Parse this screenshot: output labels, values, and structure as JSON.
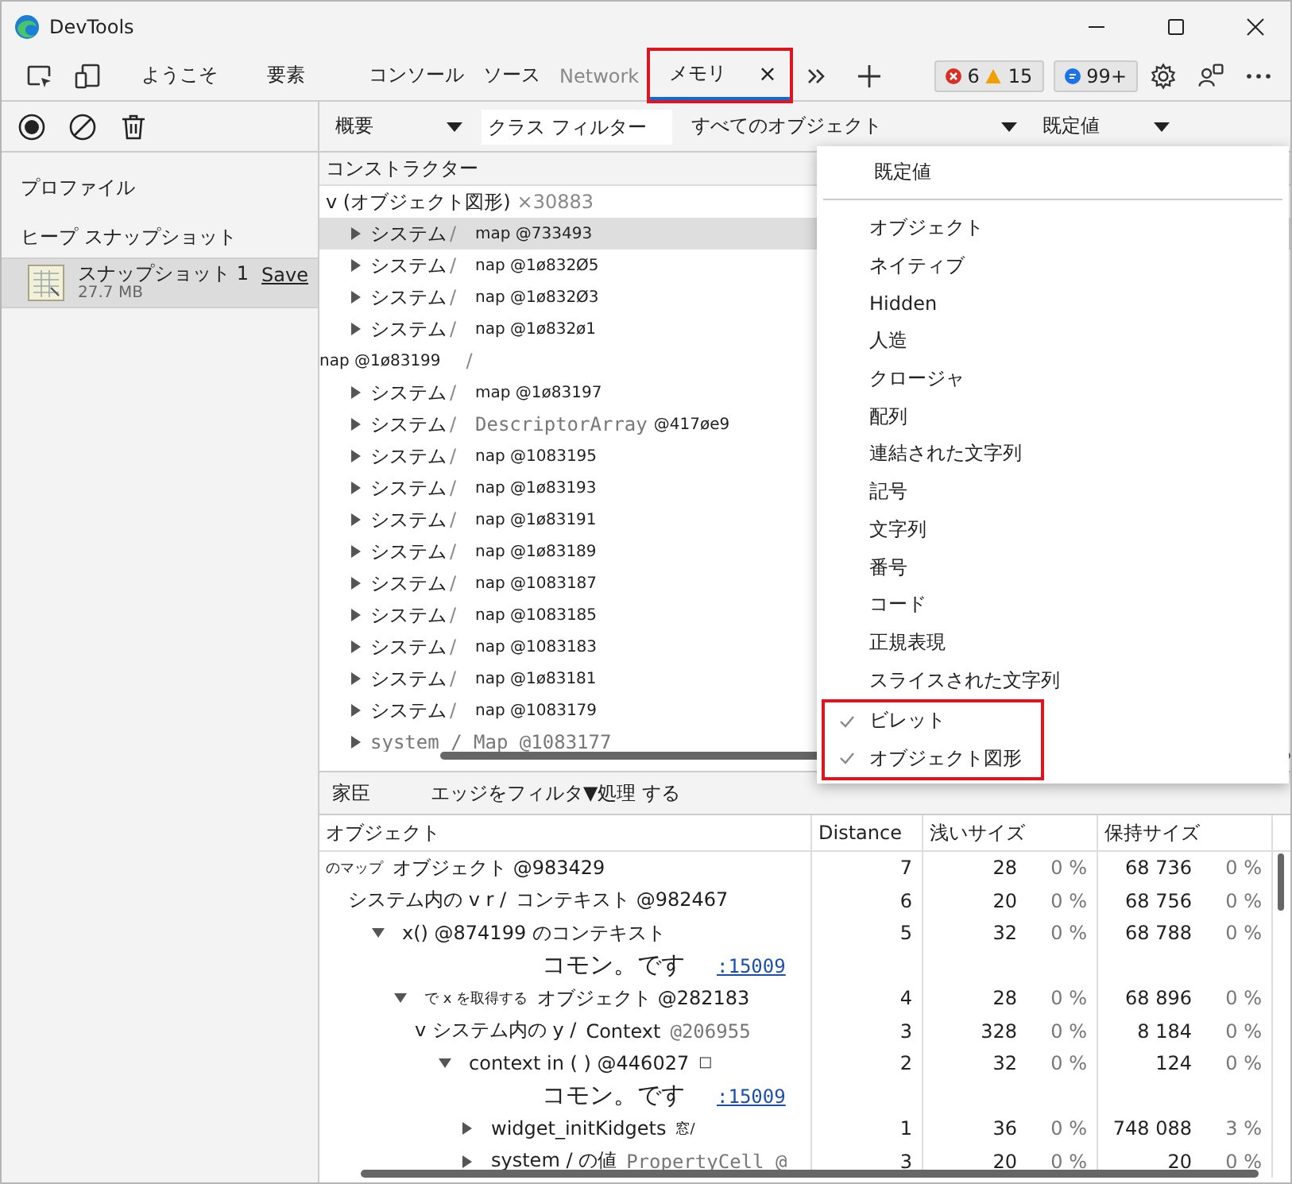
{
  "window": {
    "title": "DevTools"
  },
  "tabs": [
    {
      "label": "ようこそ",
      "selected": false,
      "disabled": false,
      "highlighted": false
    },
    {
      "label": "要素",
      "selected": false,
      "disabled": false,
      "highlighted": false
    },
    {
      "label": "コンソール",
      "selected": false,
      "disabled": false,
      "highlighted": false
    },
    {
      "label": "ソース",
      "selected": false,
      "disabled": false,
      "highlighted": false
    },
    {
      "label": "Network",
      "selected": false,
      "disabled": true,
      "highlighted": false
    },
    {
      "label": "メモリ",
      "selected": true,
      "disabled": false,
      "highlighted": true,
      "close": "×"
    }
  ],
  "status_counts": {
    "errors": "6",
    "warnings": "15",
    "issues": "99+"
  },
  "toolbar": {
    "view": "概要",
    "class_filter": {
      "placeholder": "クラス フィルター"
    },
    "object_filter": "すべてのオブジェクト",
    "preset": "既定値"
  },
  "sidebar": {
    "profiles_heading": "プロファイル",
    "group_heading": "ヒープ スナップショット",
    "snapshots": [
      {
        "name": "スナップショット 1",
        "size": "27.7 MB",
        "action": "Save",
        "selected": true
      }
    ]
  },
  "constructors": {
    "column": "コンストラクター",
    "groups": [
      {
        "label": "v (オブジェクト図形)",
        "count": "×30883",
        "children": [
          {
            "kind": "object",
            "name": "システム",
            "sep": "/",
            "detail": "map @733493",
            "expanded": false,
            "selected": true
          },
          {
            "kind": "object",
            "name": "システム",
            "sep": "/",
            "detail": "nap @1ø832Ø5",
            "expanded": false,
            "selected": false
          },
          {
            "kind": "object",
            "name": "システム",
            "sep": "/",
            "detail": "nap @1ø832Ø3",
            "expanded": false,
            "selected": false
          },
          {
            "kind": "object",
            "name": "システム",
            "sep": "/",
            "detail": "nap @1ø832ø1",
            "expanded": false,
            "selected": false
          },
          {
            "kind": "shifted",
            "sep": "/",
            "overlay": "nap @1ø83199",
            "selected": false
          },
          {
            "kind": "object",
            "name": "システム",
            "sep": "/",
            "detail": "map @1ø83197",
            "expanded": false,
            "selected": false
          },
          {
            "kind": "object",
            "name": "システム",
            "sep": "/",
            "type": "DescriptorArray",
            "detail": "@417øe9",
            "expanded": false,
            "selected": false
          },
          {
            "kind": "object",
            "name": "システム",
            "sep": "/",
            "detail": "nap @1083195",
            "expanded": false,
            "selected": false
          },
          {
            "kind": "object",
            "name": "システム",
            "sep": "/",
            "detail": "nap @1ø83193",
            "expanded": false,
            "selected": false
          },
          {
            "kind": "object",
            "name": "システム",
            "sep": "/",
            "detail": "nap @1ø83191",
            "expanded": false,
            "selected": false
          },
          {
            "kind": "object",
            "name": "システム",
            "sep": "/",
            "detail": "nap @1ø83189",
            "expanded": false,
            "selected": false
          },
          {
            "kind": "object",
            "name": "システム",
            "sep": "/",
            "detail": "nap @1083187",
            "expanded": false,
            "selected": false
          },
          {
            "kind": "object",
            "name": "システム",
            "sep": "/",
            "detail": "nap @1083185",
            "expanded": false,
            "selected": false
          },
          {
            "kind": "object",
            "name": "システム",
            "sep": "/",
            "detail": "nap @1083183",
            "expanded": false,
            "selected": false
          },
          {
            "kind": "object",
            "name": "システム",
            "sep": "/",
            "detail": "nap @1ø83181",
            "expanded": false,
            "selected": false
          },
          {
            "kind": "object",
            "name": "システム",
            "sep": "/",
            "detail": "nap @1083179",
            "expanded": false,
            "selected": false
          },
          {
            "kind": "mono",
            "text": "system / Map @1083177",
            "expanded": false,
            "selected": false
          }
        ]
      }
    ]
  },
  "type_menu": {
    "header": "既定値",
    "items": [
      {
        "label": "オブジェクト",
        "checked": false,
        "highlighted": false
      },
      {
        "label": "ネイティブ",
        "checked": false,
        "highlighted": false
      },
      {
        "label": "Hidden",
        "checked": false,
        "highlighted": false
      },
      {
        "label": "人造",
        "checked": false,
        "highlighted": false
      },
      {
        "label": "クロージャ",
        "checked": false,
        "highlighted": false
      },
      {
        "label": "配列",
        "checked": false,
        "highlighted": false
      },
      {
        "label": "連結された文字列",
        "checked": false,
        "highlighted": false
      },
      {
        "label": "記号",
        "checked": false,
        "highlighted": false
      },
      {
        "label": "文字列",
        "checked": false,
        "highlighted": false
      },
      {
        "label": "番号",
        "checked": false,
        "highlighted": false
      },
      {
        "label": "コード",
        "checked": false,
        "highlighted": false
      },
      {
        "label": "正規表現",
        "checked": false,
        "highlighted": false
      },
      {
        "label": "スライスされた文字列",
        "checked": false,
        "highlighted": false
      },
      {
        "label": "ビレット",
        "checked": true,
        "highlighted": true
      },
      {
        "label": "オブジェクト図形",
        "checked": true,
        "highlighted": true
      }
    ]
  },
  "retainers": {
    "tab": "家臣",
    "filter": "エッジをフィルタ▼処理 する",
    "columns": [
      "オブジェクト",
      "Distance",
      "浅いサイズ",
      "保持サイズ"
    ],
    "rows": [
      {
        "kind": "object",
        "parts": [
          {
            "text": "のマップ",
            "kind": "note"
          },
          {
            "text": "オブジェクト @983429",
            "kind": "text"
          }
        ],
        "distance": "7",
        "shallow": "28",
        "shallow_pct": "0 %",
        "retained": "68 736",
        "retained_pct": "0 %",
        "children": [
          {
            "kind": "object",
            "parts": [
              {
                "text": "システム内の v r /",
                "kind": "text"
              },
              {
                "text": "コンテキスト @982467",
                "kind": "text"
              }
            ],
            "distance": "6",
            "shallow": "20",
            "shallow_pct": "0 %",
            "retained": "68 756",
            "retained_pct": "0 %",
            "children": [
              {
                "kind": "object",
                "expanded": true,
                "parts": [
                  {
                    "text": "x() @874199 のコンテキスト",
                    "kind": "text"
                  }
                ],
                "distance": "5",
                "shallow": "32",
                "shallow_pct": "0 %",
                "retained": "68 788",
                "retained_pct": "0 %",
                "children": [
                  {
                    "kind": "source",
                    "text": "コモン。です",
                    "link": ":15009"
                  },
                  {
                    "kind": "object",
                    "expanded": true,
                    "parts": [
                      {
                        "text": "で x を取得する",
                        "kind": "note"
                      },
                      {
                        "text": "オブジェクト @282183",
                        "kind": "text"
                      }
                    ],
                    "distance": "4",
                    "shallow": "28",
                    "shallow_pct": "0 %",
                    "retained": "68 896",
                    "retained_pct": "0 %",
                    "children": [
                      {
                        "kind": "object",
                        "parts": [
                          {
                            "text": "v システム内の y /",
                            "kind": "text"
                          },
                          {
                            "text": "Context",
                            "kind": "text"
                          },
                          {
                            "text": "@206955",
                            "kind": "code"
                          }
                        ],
                        "distance": "3",
                        "shallow": "328",
                        "shallow_pct": "0 %",
                        "retained": "8 184",
                        "retained_pct": "0 %",
                        "children": [
                          {
                            "kind": "object",
                            "expanded": true,
                            "parts": [
                              {
                                "text": "context in ( ) @446027",
                                "kind": "text"
                              },
                              {
                                "text": "□",
                                "kind": "note"
                              }
                            ],
                            "distance": "2",
                            "shallow": "32",
                            "shallow_pct": "0 %",
                            "retained": "124",
                            "retained_pct": "0 %",
                            "children": [
                              {
                                "kind": "source",
                                "text": "コモン。です",
                                "link": ":15009"
                              },
                              {
                                "kind": "object",
                                "expanded": false,
                                "parts": [
                                  {
                                    "text": "widget_initKidgets",
                                    "kind": "text"
                                  },
                                  {
                                    "text": "窓/",
                                    "kind": "note"
                                  }
                                ],
                                "distance": "1",
                                "shallow": "36",
                                "shallow_pct": "0 %",
                                "retained": "748 088",
                                "retained_pct": "3 %"
                              },
                              {
                                "kind": "object",
                                "expanded": false,
                                "parts": [
                                  {
                                    "text": "system / の値",
                                    "kind": "text"
                                  },
                                  {
                                    "text": "PropertyCell @",
                                    "kind": "code"
                                  }
                                ],
                                "distance": "3",
                                "shallow": "20",
                                "shallow_pct": "0 %",
                                "retained": "20",
                                "retained_pct": "0 %"
                              }
                            ]
                          }
                        ]
                      }
                    ]
                  }
                ]
              }
            ]
          }
        ]
      }
    ]
  }
}
